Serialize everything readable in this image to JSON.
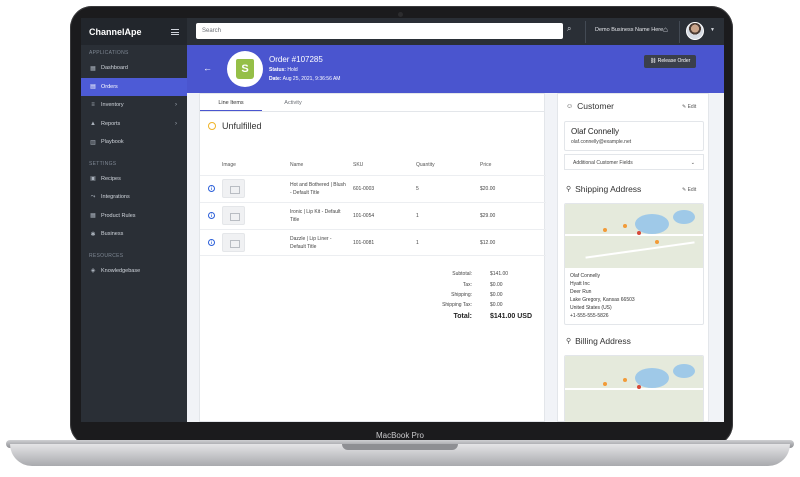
{
  "device": {
    "brand": "MacBook Pro"
  },
  "sidebar": {
    "logo": "ChannelApe",
    "sections": [
      "APPLICATIONS",
      "SETTINGS",
      "RESOURCES"
    ],
    "items": [
      {
        "label": "Dashboard",
        "icon": "dashboard-icon"
      },
      {
        "label": "Orders",
        "icon": "cart-icon"
      },
      {
        "label": "Inventory",
        "icon": "list-icon"
      },
      {
        "label": "Reports",
        "icon": "chart-icon"
      },
      {
        "label": "Playbook",
        "icon": "book-icon"
      },
      {
        "label": "Recipes",
        "icon": "recipe-icon"
      },
      {
        "label": "Integrations",
        "icon": "integrations-icon"
      },
      {
        "label": "Product Rules",
        "icon": "rules-icon"
      },
      {
        "label": "Business",
        "icon": "business-icon"
      },
      {
        "label": "Knowledgebase",
        "icon": "knowledge-icon"
      }
    ]
  },
  "topbar": {
    "search_placeholder": "Search",
    "business_name": "Demo Business Name Here"
  },
  "order": {
    "title": "Order #107285",
    "status_label": "Status:",
    "status": "Hold",
    "date_label": "Date:",
    "date": "Aug 25, 2021, 9:36:56 AM",
    "release_label": "Release Order"
  },
  "tabs": [
    "Line Items",
    "Activity"
  ],
  "fulfillment": {
    "status": "Unfulfilled"
  },
  "table": {
    "headers": [
      "Image",
      "Name",
      "SKU",
      "Quantity",
      "Price"
    ],
    "rows": [
      {
        "name": "Hot and Bothered | Blush - Default Title",
        "sku": "601-0003",
        "qty": "5",
        "price": "$20.00"
      },
      {
        "name": "Ironic | Lip Kit - Default Title",
        "sku": "101-0054",
        "qty": "1",
        "price": "$29.00"
      },
      {
        "name": "Dazzle | Lip Liner - Default Title",
        "sku": "101-0081",
        "qty": "1",
        "price": "$12.00"
      }
    ]
  },
  "totals": {
    "subtotal_label": "Subtotal:",
    "subtotal": "$141.00",
    "tax_label": "Tax:",
    "tax": "$0.00",
    "shipping_label": "Shipping:",
    "shipping": "$0.00",
    "shipping_tax_label": "Shipping Tax:",
    "shipping_tax": "$0.00",
    "total_label": "Total:",
    "total": "$141.00 USD"
  },
  "customer": {
    "heading": "Customer",
    "edit": "Edit",
    "name": "Olaf Connelly",
    "email": "olaf.connelly@example.net",
    "additional_fields": "Additional Customer Fields"
  },
  "shipping": {
    "heading": "Shipping Address",
    "edit": "Edit",
    "lines": [
      "Olaf Connelly",
      "Hyatt Inc",
      "Deer Run",
      "Lake Gregory, Kansas 66503",
      "United States (US)",
      "+1-555-555-5826"
    ]
  },
  "billing": {
    "heading": "Billing Address"
  },
  "colors": {
    "accent": "#4a55cf",
    "sidebar": "#2a2f36",
    "shopify": "#95bf47",
    "pending": "#f0b429"
  }
}
